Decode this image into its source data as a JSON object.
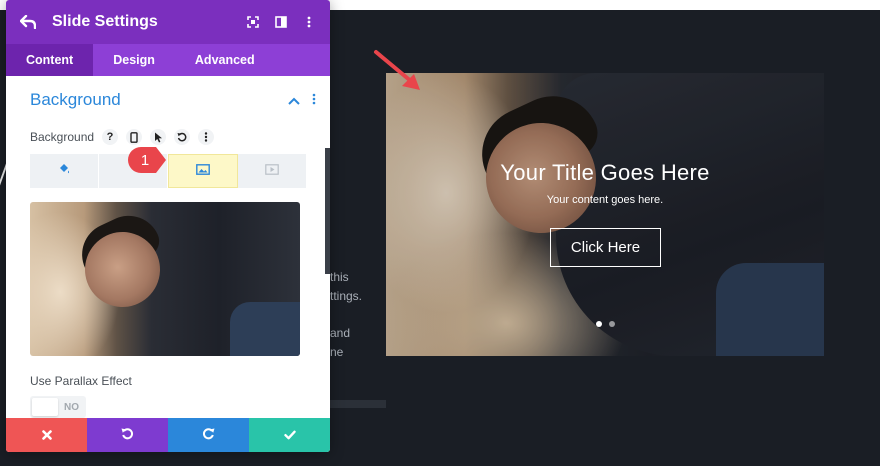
{
  "panel": {
    "title": "Slide Settings",
    "tabs": [
      {
        "label": "Content",
        "active": true
      },
      {
        "label": "Design",
        "active": false
      },
      {
        "label": "Advanced",
        "active": false
      }
    ],
    "section": {
      "title": "Background"
    },
    "background_option": {
      "label": "Background"
    },
    "background_tabs": [
      "color-fill-icon",
      "image-icon",
      "video-icon"
    ],
    "active_background_tab": "image-icon",
    "step_badge": "1",
    "parallax": {
      "label": "Use Parallax Effect",
      "toggle_text": "NO"
    },
    "footer": {
      "cancel": {
        "color": "#ef5555"
      },
      "undo": {
        "color": "#7e3bd0"
      },
      "redo": {
        "color": "#2b87da"
      },
      "save": {
        "color": "#29c4a9"
      }
    }
  },
  "colors": {
    "header_purple": "#7b2fbe",
    "tab_purple": "#8d3fd6",
    "accent_blue": "#2b87da",
    "highlight_yellow": "#fdf8c8",
    "arrow_red": "#e9454b"
  },
  "background_text": {
    "line1": "this",
    "line2": "ttings.",
    "line3": "and",
    "line4": "ne"
  },
  "slide": {
    "title": "Your Title Goes Here",
    "content": "Your content goes here.",
    "button": "Click Here",
    "dots": 2,
    "active_dot": 1
  }
}
